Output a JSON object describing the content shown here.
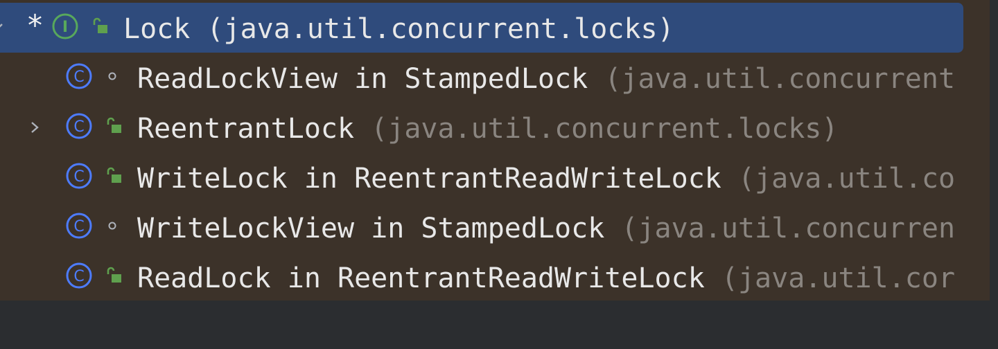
{
  "colors": {
    "tree_background": "#3c3229",
    "selected_row": "#2f4b7c",
    "class_icon": "#4d7cff",
    "interface_icon": "#58a85c",
    "public_modifier": "#5fa04e",
    "package_text": "#8a8580",
    "main_text": "#e8e8e8"
  },
  "tree": {
    "rows": [
      {
        "expand_icon": "chevron-down-icon",
        "marker": "*",
        "kind_icon": "interface-icon",
        "modifier_icon": "public-lock-icon",
        "name": "Lock (java.util.concurrent.locks)",
        "package": "",
        "selected": true
      },
      {
        "kind_icon": "class-icon",
        "modifier_icon": "package-private-icon",
        "name": "ReadLockView in StampedLock",
        "package": "(java.util.concurrent"
      },
      {
        "expand_icon": "chevron-right-icon",
        "kind_icon": "class-icon",
        "modifier_icon": "public-lock-icon",
        "name": "ReentrantLock",
        "package": "(java.util.concurrent.locks)"
      },
      {
        "kind_icon": "class-icon",
        "modifier_icon": "public-lock-icon",
        "name": "WriteLock in ReentrantReadWriteLock",
        "package": "(java.util.co"
      },
      {
        "kind_icon": "class-icon",
        "modifier_icon": "package-private-icon",
        "name": "WriteLockView in StampedLock",
        "package": "(java.util.concurren"
      },
      {
        "kind_icon": "class-icon",
        "modifier_icon": "public-lock-icon",
        "name": "ReadLock in ReentrantReadWriteLock",
        "package": "(java.util.cor"
      }
    ]
  }
}
